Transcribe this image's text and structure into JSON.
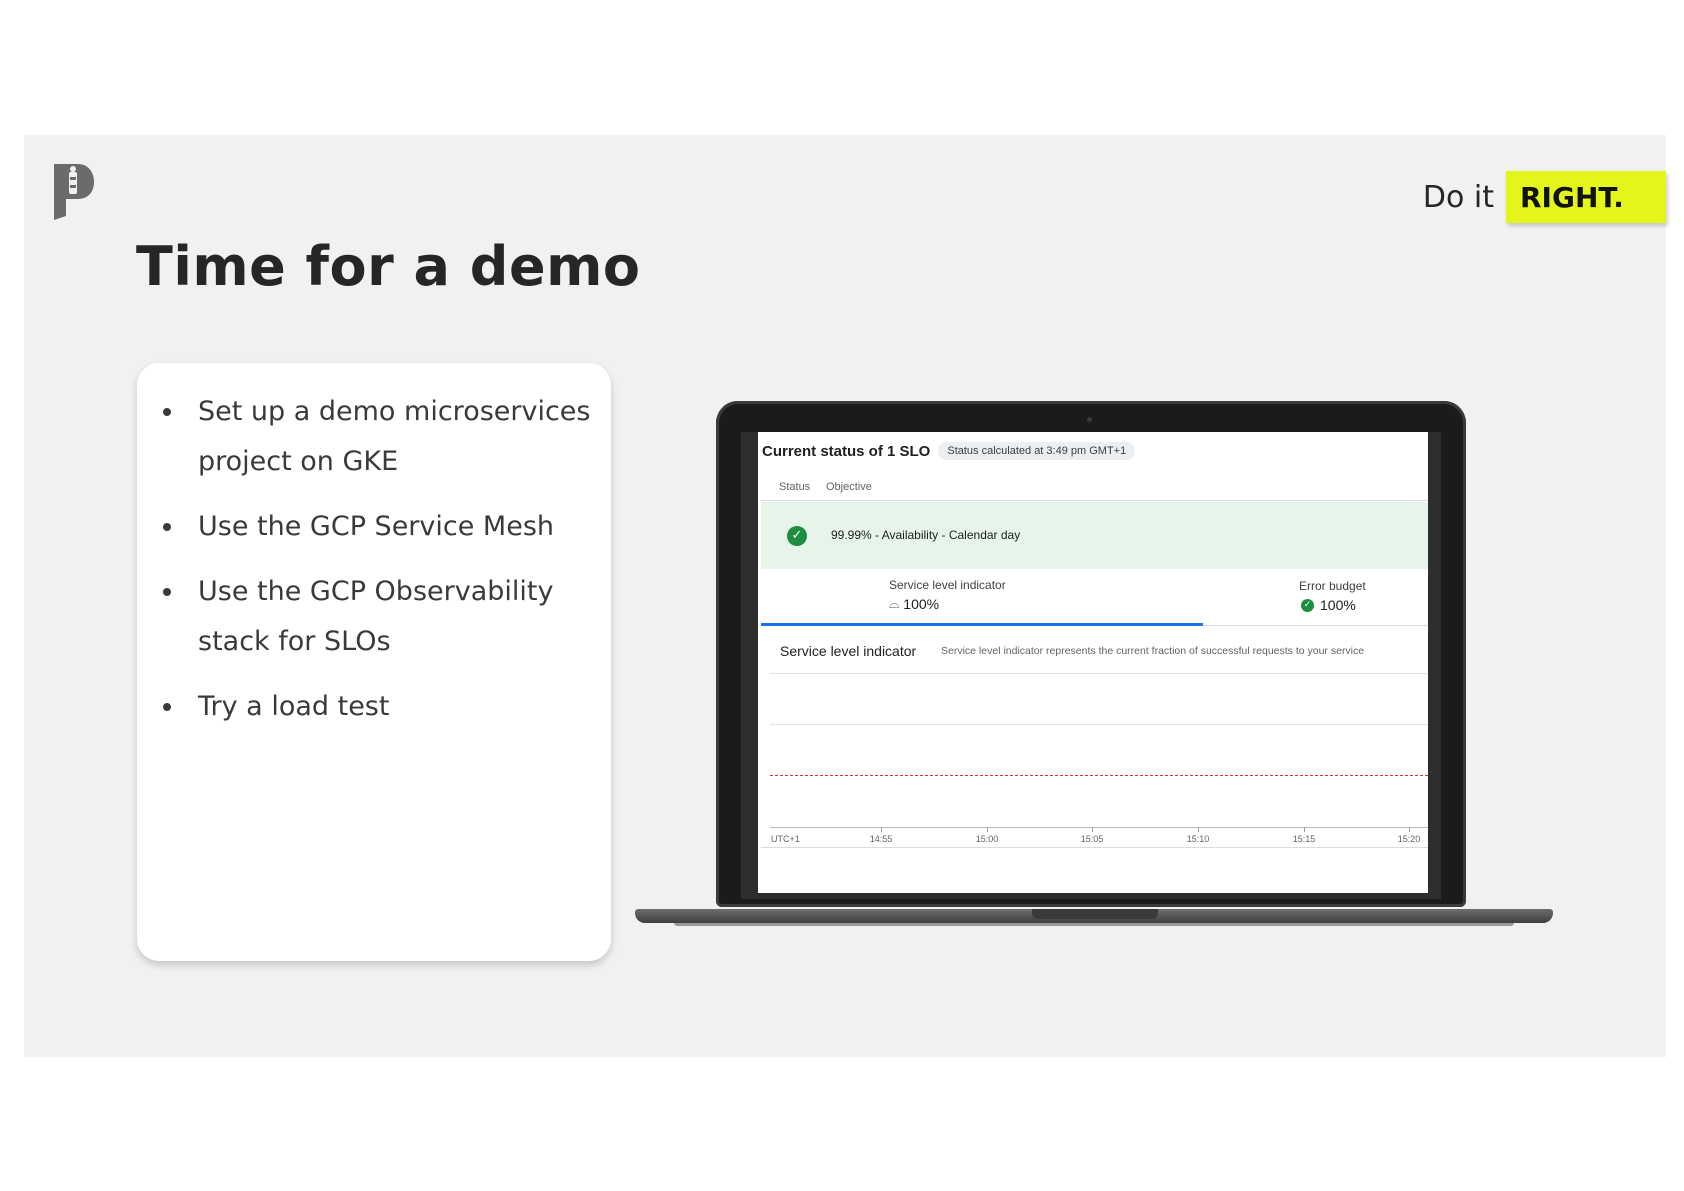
{
  "slide": {
    "title": "Time for a demo",
    "tagline_prefix": "Do it",
    "tagline_highlight": "RIGHT.",
    "highlight_color": "#e4f51a",
    "logo_icon": "p-logo-icon"
  },
  "bullets": [
    "Set up a demo microservices project on GKE",
    "Use the GCP Service Mesh",
    "Use the GCP Observability stack for SLOs",
    "Try a load test"
  ],
  "screen": {
    "header_title": "Current status of 1 SLO",
    "status_chip": "Status calculated at 3:49 pm GMT+1",
    "col_status": "Status",
    "col_objective": "Objective",
    "objective": "99.99% - Availability - Calendar day",
    "sli_label": "Service level indicator",
    "sli_value": "100%",
    "error_budget_label": "Error budget",
    "error_budget_value": "100%",
    "section_title": "Service level indicator",
    "section_desc": "Service level indicator represents the current fraction of successful requests to your service",
    "timezone": "UTC+1",
    "ticks": [
      "14:55",
      "15:00",
      "15:05",
      "15:10",
      "15:15",
      "15:20"
    ],
    "status_color": "#1e8e3e",
    "threshold_color": "#d93025"
  }
}
